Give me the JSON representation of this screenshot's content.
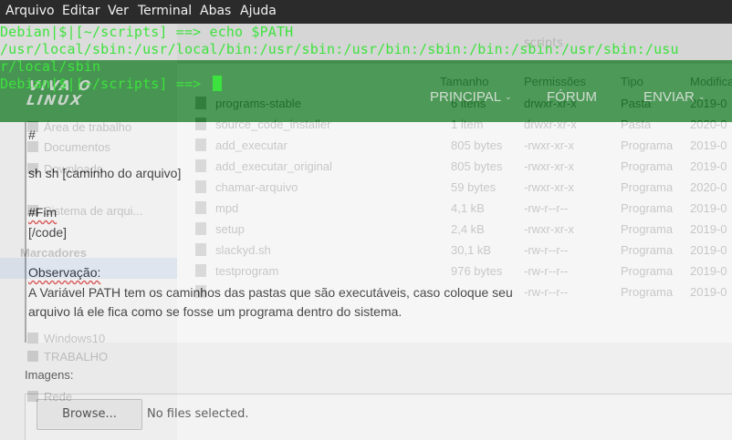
{
  "terminal": {
    "menu": [
      "Arquivo",
      "Editar",
      "Ver",
      "Terminal",
      "Abas",
      "Ajuda"
    ],
    "lines": [
      "Debian|$|[~/scripts] ==> echo $PATH",
      "/usr/local/sbin:/usr/local/bin:/usr/sbin:/usr/bin:/sbin:/bin:/sbin:/usr/sbin:/usu",
      "r/local/sbin",
      "Debian|$|[~/scripts] ==> "
    ]
  },
  "site": {
    "logo": "VIVA O LINUX",
    "nav": [
      "PRINCIPAL",
      "FÓRUM",
      "ENVIAR"
    ],
    "caret": "⌄"
  },
  "editor": {
    "lines": [
      "#",
      "sh [caminho do arquivo]",
      "#Fim",
      "[/code]",
      "Observação:",
      "A Variável PATH tem os caminhos das pastas que são executáveis, caso coloque seu",
      "arquivo lá ele fica como se fosse um programa dentro do sistema."
    ]
  },
  "upload": {
    "label": "Imagens:",
    "browse": "Browse...",
    "status": "No files selected."
  },
  "filemanager": {
    "path": "scripts",
    "columns": [
      "Tamanho",
      "Permissões",
      "Tipo",
      "Modificado"
    ],
    "sidebar": [
      {
        "label": "Área de trabalho",
        "section": false
      },
      {
        "label": "Documentos",
        "section": false
      },
      {
        "label": "Downloads",
        "section": false
      },
      {
        "label": "Sistema de arqui...",
        "section": false
      },
      {
        "label": "Marcadores",
        "section": true
      },
      {
        "label": "Windows10",
        "section": false
      },
      {
        "label": "TRABALHO",
        "section": false
      },
      {
        "label": "Rede",
        "section": false
      }
    ],
    "rows": [
      {
        "name": "programs-stable",
        "size": "6 itens",
        "perm": "drwxr-xr-x",
        "type": "Pasta",
        "date": "2019-0"
      },
      {
        "name": "source_code_installer",
        "size": "1 item",
        "perm": "drwxr-xr-x",
        "type": "Pasta",
        "date": "2020-0"
      },
      {
        "name": "add_executar",
        "size": "805 bytes",
        "perm": "-rwxr-xr-x",
        "type": "Programa",
        "date": "2019-0"
      },
      {
        "name": "add_executar_original",
        "size": "805 bytes",
        "perm": "-rwxr-xr-x",
        "type": "Programa",
        "date": "2019-0"
      },
      {
        "name": "chamar-arquivo",
        "size": "59 bytes",
        "perm": "-rwxr-xr-x",
        "type": "Programa",
        "date": "2020-0"
      },
      {
        "name": "mpd",
        "size": "4,1 kB",
        "perm": "-rw-r--r--",
        "type": "Programa",
        "date": "2019-0"
      },
      {
        "name": "setup",
        "size": "2,4 kB",
        "perm": "-rwxr-xr-x",
        "type": "Programa",
        "date": "2019-0"
      },
      {
        "name": "slackyd.sh",
        "size": "30,1 kB",
        "perm": "-rw-r--r--",
        "type": "Programa",
        "date": "2019-0"
      },
      {
        "name": "testprogram",
        "size": "976 bytes",
        "perm": "-rw-r--r--",
        "type": "Programa",
        "date": "2019-0"
      },
      {
        "name": "",
        "size": "",
        "perm": "-rw-r--r--",
        "type": "Programa",
        "date": "2019-0"
      }
    ]
  }
}
